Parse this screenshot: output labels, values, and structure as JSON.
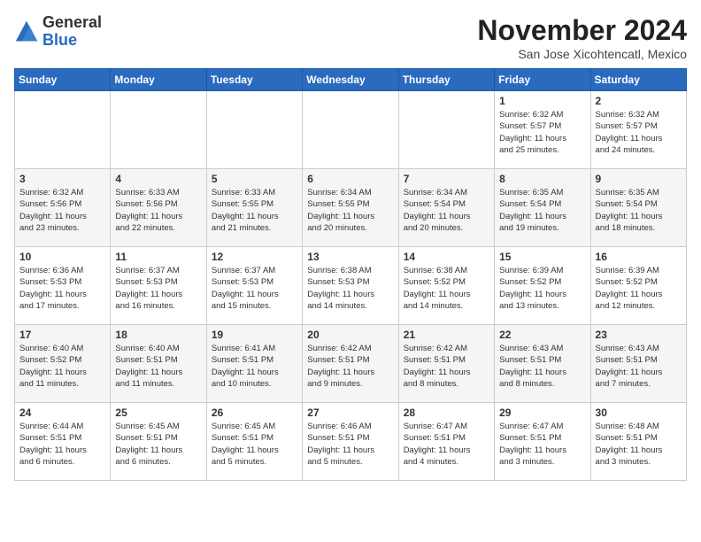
{
  "logo": {
    "general": "General",
    "blue": "Blue"
  },
  "header": {
    "month": "November 2024",
    "location": "San Jose Xicohtencatl, Mexico"
  },
  "days_of_week": [
    "Sunday",
    "Monday",
    "Tuesday",
    "Wednesday",
    "Thursday",
    "Friday",
    "Saturday"
  ],
  "weeks": [
    [
      {
        "day": "",
        "info": ""
      },
      {
        "day": "",
        "info": ""
      },
      {
        "day": "",
        "info": ""
      },
      {
        "day": "",
        "info": ""
      },
      {
        "day": "",
        "info": ""
      },
      {
        "day": "1",
        "info": "Sunrise: 6:32 AM\nSunset: 5:57 PM\nDaylight: 11 hours\nand 25 minutes."
      },
      {
        "day": "2",
        "info": "Sunrise: 6:32 AM\nSunset: 5:57 PM\nDaylight: 11 hours\nand 24 minutes."
      }
    ],
    [
      {
        "day": "3",
        "info": "Sunrise: 6:32 AM\nSunset: 5:56 PM\nDaylight: 11 hours\nand 23 minutes."
      },
      {
        "day": "4",
        "info": "Sunrise: 6:33 AM\nSunset: 5:56 PM\nDaylight: 11 hours\nand 22 minutes."
      },
      {
        "day": "5",
        "info": "Sunrise: 6:33 AM\nSunset: 5:55 PM\nDaylight: 11 hours\nand 21 minutes."
      },
      {
        "day": "6",
        "info": "Sunrise: 6:34 AM\nSunset: 5:55 PM\nDaylight: 11 hours\nand 20 minutes."
      },
      {
        "day": "7",
        "info": "Sunrise: 6:34 AM\nSunset: 5:54 PM\nDaylight: 11 hours\nand 20 minutes."
      },
      {
        "day": "8",
        "info": "Sunrise: 6:35 AM\nSunset: 5:54 PM\nDaylight: 11 hours\nand 19 minutes."
      },
      {
        "day": "9",
        "info": "Sunrise: 6:35 AM\nSunset: 5:54 PM\nDaylight: 11 hours\nand 18 minutes."
      }
    ],
    [
      {
        "day": "10",
        "info": "Sunrise: 6:36 AM\nSunset: 5:53 PM\nDaylight: 11 hours\nand 17 minutes."
      },
      {
        "day": "11",
        "info": "Sunrise: 6:37 AM\nSunset: 5:53 PM\nDaylight: 11 hours\nand 16 minutes."
      },
      {
        "day": "12",
        "info": "Sunrise: 6:37 AM\nSunset: 5:53 PM\nDaylight: 11 hours\nand 15 minutes."
      },
      {
        "day": "13",
        "info": "Sunrise: 6:38 AM\nSunset: 5:53 PM\nDaylight: 11 hours\nand 14 minutes."
      },
      {
        "day": "14",
        "info": "Sunrise: 6:38 AM\nSunset: 5:52 PM\nDaylight: 11 hours\nand 14 minutes."
      },
      {
        "day": "15",
        "info": "Sunrise: 6:39 AM\nSunset: 5:52 PM\nDaylight: 11 hours\nand 13 minutes."
      },
      {
        "day": "16",
        "info": "Sunrise: 6:39 AM\nSunset: 5:52 PM\nDaylight: 11 hours\nand 12 minutes."
      }
    ],
    [
      {
        "day": "17",
        "info": "Sunrise: 6:40 AM\nSunset: 5:52 PM\nDaylight: 11 hours\nand 11 minutes."
      },
      {
        "day": "18",
        "info": "Sunrise: 6:40 AM\nSunset: 5:51 PM\nDaylight: 11 hours\nand 11 minutes."
      },
      {
        "day": "19",
        "info": "Sunrise: 6:41 AM\nSunset: 5:51 PM\nDaylight: 11 hours\nand 10 minutes."
      },
      {
        "day": "20",
        "info": "Sunrise: 6:42 AM\nSunset: 5:51 PM\nDaylight: 11 hours\nand 9 minutes."
      },
      {
        "day": "21",
        "info": "Sunrise: 6:42 AM\nSunset: 5:51 PM\nDaylight: 11 hours\nand 8 minutes."
      },
      {
        "day": "22",
        "info": "Sunrise: 6:43 AM\nSunset: 5:51 PM\nDaylight: 11 hours\nand 8 minutes."
      },
      {
        "day": "23",
        "info": "Sunrise: 6:43 AM\nSunset: 5:51 PM\nDaylight: 11 hours\nand 7 minutes."
      }
    ],
    [
      {
        "day": "24",
        "info": "Sunrise: 6:44 AM\nSunset: 5:51 PM\nDaylight: 11 hours\nand 6 minutes."
      },
      {
        "day": "25",
        "info": "Sunrise: 6:45 AM\nSunset: 5:51 PM\nDaylight: 11 hours\nand 6 minutes."
      },
      {
        "day": "26",
        "info": "Sunrise: 6:45 AM\nSunset: 5:51 PM\nDaylight: 11 hours\nand 5 minutes."
      },
      {
        "day": "27",
        "info": "Sunrise: 6:46 AM\nSunset: 5:51 PM\nDaylight: 11 hours\nand 5 minutes."
      },
      {
        "day": "28",
        "info": "Sunrise: 6:47 AM\nSunset: 5:51 PM\nDaylight: 11 hours\nand 4 minutes."
      },
      {
        "day": "29",
        "info": "Sunrise: 6:47 AM\nSunset: 5:51 PM\nDaylight: 11 hours\nand 3 minutes."
      },
      {
        "day": "30",
        "info": "Sunrise: 6:48 AM\nSunset: 5:51 PM\nDaylight: 11 hours\nand 3 minutes."
      }
    ]
  ]
}
